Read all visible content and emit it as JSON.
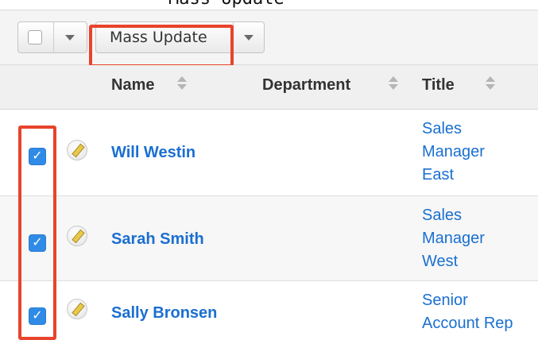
{
  "top_text": "Mass Update",
  "toolbar": {
    "mass_update_label": "Mass Update"
  },
  "columns": [
    {
      "label": "Name"
    },
    {
      "label": "Department"
    },
    {
      "label": "Title"
    }
  ],
  "rows": [
    {
      "name": "Will Westin",
      "title_lines": [
        "Sales",
        "Manager",
        "East"
      ],
      "checked": true
    },
    {
      "name": "Sarah Smith",
      "title_lines": [
        "Sales",
        "Manager",
        "West"
      ],
      "checked": true
    },
    {
      "name": "Sally Bronsen",
      "title_lines": [
        "Senior",
        "Account Rep"
      ],
      "checked": true
    }
  ],
  "icons": {
    "checkbox_checked": "check-icon",
    "edit": "pencil-icon",
    "sort": "sort-icon",
    "dropdown": "caret-down-icon"
  },
  "colors": {
    "link": "#1a6fd1",
    "checkbox": "#2f8be6",
    "highlight": "#e8432c"
  }
}
